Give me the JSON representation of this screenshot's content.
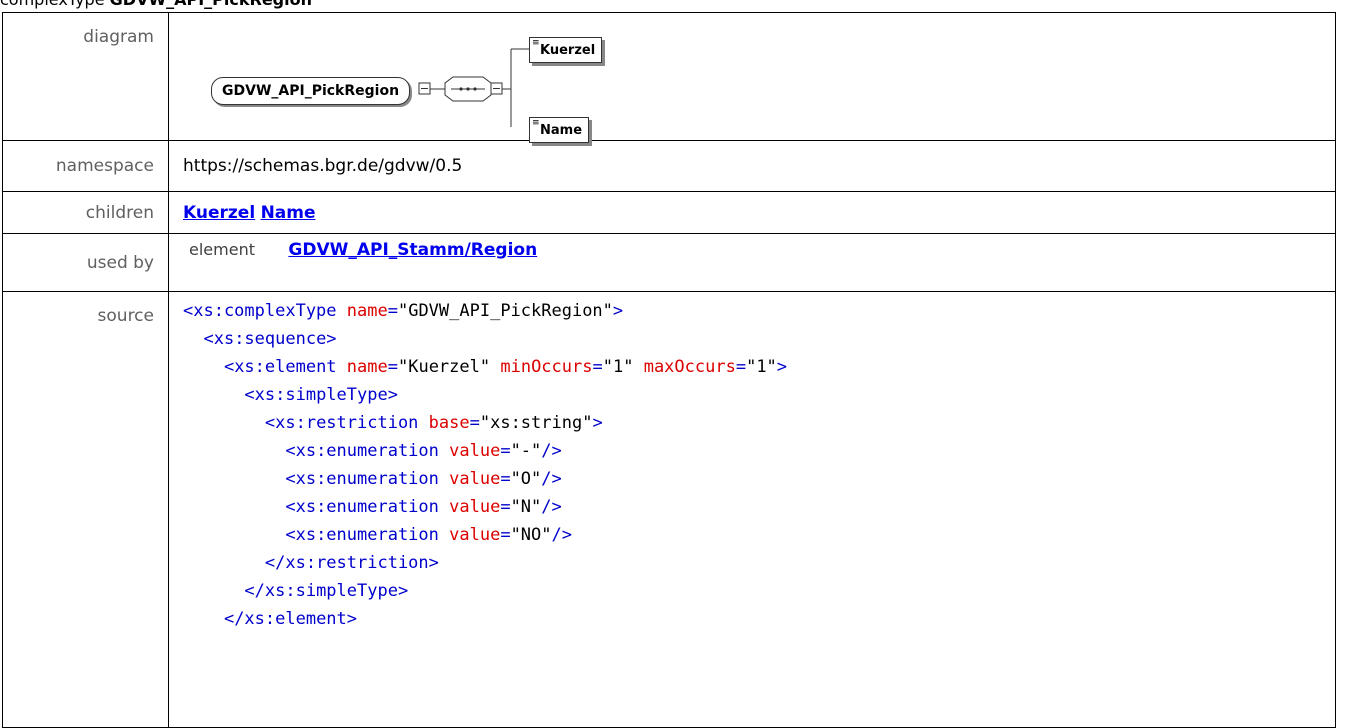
{
  "heading": {
    "kind": "complexType",
    "name": "GDVW_API_PickRegion"
  },
  "rows": {
    "diagram_label": "diagram",
    "namespace_label": "namespace",
    "children_label": "children",
    "usedby_label": "used by",
    "source_label": "source"
  },
  "diagram": {
    "type_name": "GDVW_API_PickRegion",
    "elements": [
      "Kuerzel",
      "Name"
    ]
  },
  "namespace": "https://schemas.bgr.de/gdvw/0.5",
  "children": [
    "Kuerzel",
    "Name"
  ],
  "used_by": {
    "kind": "element",
    "link": "GDVW_API_Stamm/Region"
  },
  "source_lines": [
    [
      [
        "t",
        "<xs:complexType "
      ],
      [
        "a",
        "name"
      ],
      [
        "t",
        "="
      ],
      [
        "v",
        "\"GDVW_API_PickRegion\""
      ],
      [
        "t",
        ">"
      ]
    ],
    [
      [
        "i",
        "  "
      ],
      [
        "t",
        "<xs:sequence>"
      ]
    ],
    [
      [
        "i",
        "    "
      ],
      [
        "t",
        "<xs:element "
      ],
      [
        "a",
        "name"
      ],
      [
        "t",
        "="
      ],
      [
        "v",
        "\"Kuerzel\""
      ],
      [
        "t",
        " "
      ],
      [
        "a",
        "minOccurs"
      ],
      [
        "t",
        "="
      ],
      [
        "v",
        "\"1\""
      ],
      [
        "t",
        " "
      ],
      [
        "a",
        "maxOccurs"
      ],
      [
        "t",
        "="
      ],
      [
        "v",
        "\"1\""
      ],
      [
        "t",
        ">"
      ]
    ],
    [
      [
        "i",
        "      "
      ],
      [
        "t",
        "<xs:simpleType>"
      ]
    ],
    [
      [
        "i",
        "        "
      ],
      [
        "t",
        "<xs:restriction "
      ],
      [
        "a",
        "base"
      ],
      [
        "t",
        "="
      ],
      [
        "v",
        "\"xs:string\""
      ],
      [
        "t",
        ">"
      ]
    ],
    [
      [
        "i",
        "          "
      ],
      [
        "t",
        "<xs:enumeration "
      ],
      [
        "a",
        "value"
      ],
      [
        "t",
        "="
      ],
      [
        "v",
        "\"-\""
      ],
      [
        "t",
        "/>"
      ]
    ],
    [
      [
        "i",
        "          "
      ],
      [
        "t",
        "<xs:enumeration "
      ],
      [
        "a",
        "value"
      ],
      [
        "t",
        "="
      ],
      [
        "v",
        "\"O\""
      ],
      [
        "t",
        "/>"
      ]
    ],
    [
      [
        "i",
        "          "
      ],
      [
        "t",
        "<xs:enumeration "
      ],
      [
        "a",
        "value"
      ],
      [
        "t",
        "="
      ],
      [
        "v",
        "\"N\""
      ],
      [
        "t",
        "/>"
      ]
    ],
    [
      [
        "i",
        "          "
      ],
      [
        "t",
        "<xs:enumeration "
      ],
      [
        "a",
        "value"
      ],
      [
        "t",
        "="
      ],
      [
        "v",
        "\"NO\""
      ],
      [
        "t",
        "/>"
      ]
    ],
    [
      [
        "i",
        "        "
      ],
      [
        "t",
        "</xs:restriction>"
      ]
    ],
    [
      [
        "i",
        "      "
      ],
      [
        "t",
        "</xs:simpleType>"
      ]
    ],
    [
      [
        "i",
        "    "
      ],
      [
        "t",
        "</xs:element>"
      ]
    ]
  ]
}
